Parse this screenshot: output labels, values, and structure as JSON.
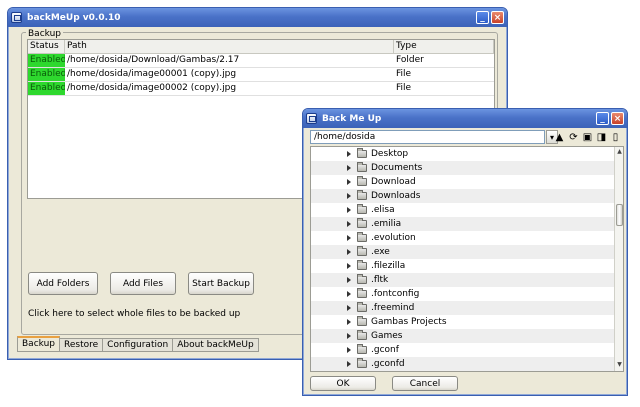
{
  "main_window": {
    "title": "backMeUp v0.0.10",
    "group_label": "Backup",
    "columns": [
      "Status",
      "Path",
      "Type"
    ],
    "rows": [
      {
        "status": "Enabled",
        "path": "/home/dosida/Download/Gambas/2.17",
        "type": "Folder"
      },
      {
        "status": "Enabled",
        "path": "/home/dosida/image00001 (copy).jpg",
        "type": "File"
      },
      {
        "status": "Enabled",
        "path": "/home/dosida/image00002 (copy).jpg",
        "type": "File"
      }
    ],
    "buttons": {
      "add_folders": "Add Folders",
      "add_files": "Add Files",
      "start_backup": "Start Backup"
    },
    "hint": "Click here to select whole files to be backed up",
    "tabs": [
      "Backup",
      "Restore",
      "Configuration",
      "About backMeUp"
    ],
    "active_tab": "Backup"
  },
  "dialog": {
    "title": "Back Me Up",
    "path": "/home/dosida",
    "folders": [
      "Desktop",
      "Documents",
      "Download",
      "Downloads",
      ".elisa",
      ".emilia",
      ".evolution",
      ".exe",
      ".filezilla",
      ".fltk",
      ".fontconfig",
      ".freemind",
      "Gambas Projects",
      "Games",
      ".gconf",
      ".gconfd"
    ],
    "ok_label": "OK",
    "cancel_label": "Cancel"
  },
  "colors": {
    "enabled": "#2ed82e",
    "titlebar": "#4a72c8"
  }
}
